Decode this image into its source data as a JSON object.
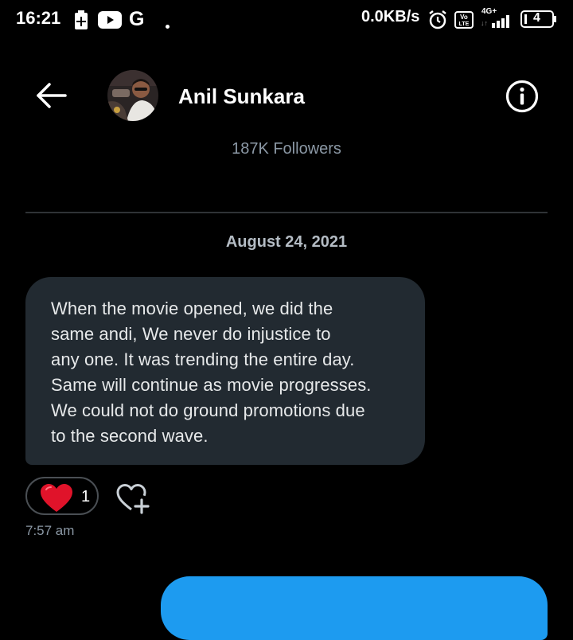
{
  "status_bar": {
    "time": "16:21",
    "speed": "0.0KB/s",
    "network": "4G+",
    "volte": "Vo LTE",
    "battery": "4",
    "icons": [
      "battery-saver-icon",
      "youtube-icon",
      "google-icon",
      "dot-icon",
      "alarm-icon",
      "volte-icon",
      "signal-icon",
      "battery-icon"
    ]
  },
  "header": {
    "name": "Anil Sunkara",
    "followers": "187K Followers"
  },
  "conversation": {
    "date": "August 24, 2021",
    "message": {
      "lines": [
        "When the movie opened, we did the",
        "same andi, We never do injustice to",
        "any one. It was trending the entire day.",
        "Same will continue as movie progresses.",
        "We could not do ground promotions due",
        "to the second wave."
      ],
      "reaction_count": "1",
      "time": "7:57 am"
    }
  },
  "colors": {
    "background": "#000000",
    "bubble": "#222a31",
    "accent": "#1d9bf0",
    "muted_text": "#8b98a5",
    "heart": "#e0132a"
  }
}
